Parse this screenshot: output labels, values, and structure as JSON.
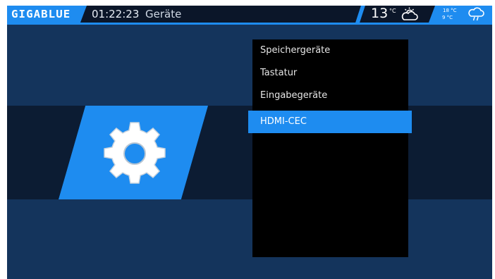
{
  "header": {
    "logo": "GIGABLUE",
    "clock": "01:22:23",
    "title": "Geräte"
  },
  "weather": {
    "current_temp": "13",
    "current_unit": "°C",
    "current_icon": "cloud-sun-icon",
    "forecast_high": "18 °C",
    "forecast_low": "9 °C",
    "forecast_icon": "cloud-rain-icon"
  },
  "menu": {
    "items": [
      {
        "label": "Speichergeräte"
      },
      {
        "label": "Tastatur"
      },
      {
        "label": "Eingabegeräte"
      },
      {
        "label": "HDMI-CEC"
      }
    ],
    "selected_index": 3
  },
  "colors": {
    "accent": "#1e8cf0",
    "background": "#14345c",
    "band": "#0c1c33",
    "menu_background": "#000000"
  },
  "section_icon": "gear-icon"
}
